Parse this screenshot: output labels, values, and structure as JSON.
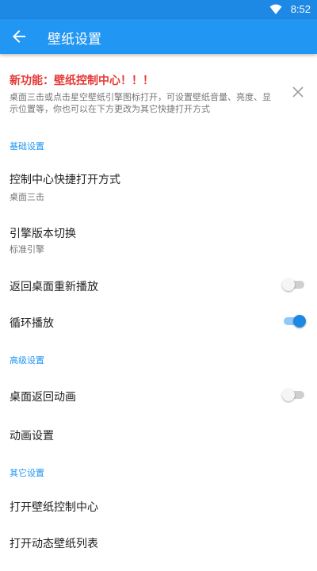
{
  "status_bar": {
    "time": "8:52",
    "wifi_icon": "wifi-icon"
  },
  "app_bar": {
    "title": "壁纸设置",
    "back_icon": "arrow-back-icon"
  },
  "banner": {
    "title": "新功能：壁纸控制中心！！！",
    "description": "桌面三击或点击星空壁纸引擎图标打开，可设置壁纸音量、亮度、显示位置等，你也可以在下方更改为其它快捷打开方式",
    "close_icon": "close-icon"
  },
  "sections": {
    "basic": {
      "header": "基础设置",
      "shortcut": {
        "title": "控制中心快捷打开方式",
        "value": "桌面三击"
      },
      "engine": {
        "title": "引擎版本切换",
        "value": "标准引擎"
      },
      "replay_on_home": {
        "title": "返回桌面重新播放",
        "enabled": false
      },
      "loop_play": {
        "title": "循环播放",
        "enabled": true
      }
    },
    "advanced": {
      "header": "高级设置",
      "home_animation": {
        "title": "桌面返回动画",
        "enabled": false
      },
      "animation_settings": {
        "title": "动画设置"
      }
    },
    "other": {
      "header": "其它设置",
      "open_control_center": {
        "title": "打开壁纸控制中心"
      },
      "open_live_list": {
        "title": "打开动态壁纸列表"
      }
    }
  },
  "colors": {
    "primary": "#2196f3",
    "status_bar": "#1e88e5",
    "accent": "#1e88e5",
    "banner_title": "#e53935",
    "secondary_text": "#757575"
  }
}
